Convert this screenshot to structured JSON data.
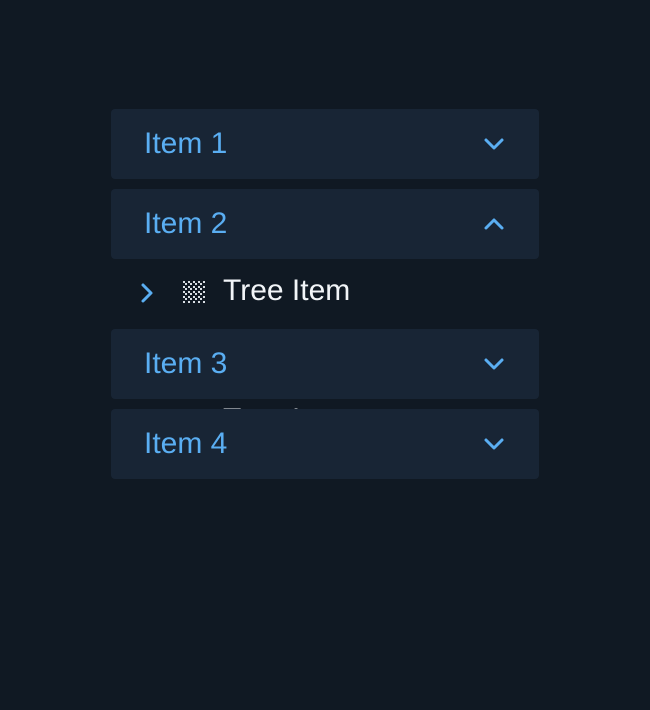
{
  "accordion": {
    "items": [
      {
        "label": "Item 1",
        "state": "collapsed",
        "chevron": "chevron-down-icon"
      },
      {
        "label": "Item 2",
        "state": "expanded",
        "chevron": "chevron-up-icon"
      },
      {
        "label": "Item 3",
        "state": "collapsed",
        "chevron": "chevron-down-icon"
      },
      {
        "label": "Item 4",
        "state": "collapsed",
        "chevron": "chevron-down-icon"
      }
    ],
    "tree_item": {
      "label": "Tree Item",
      "caret": "chevron-right-icon",
      "icon": "grid-icon"
    },
    "ghost_text": "Tree Item"
  },
  "colors": {
    "background": "#101923",
    "header_bg": "#182535",
    "accent": "#5aaef2",
    "text": "#f2f5f8"
  }
}
